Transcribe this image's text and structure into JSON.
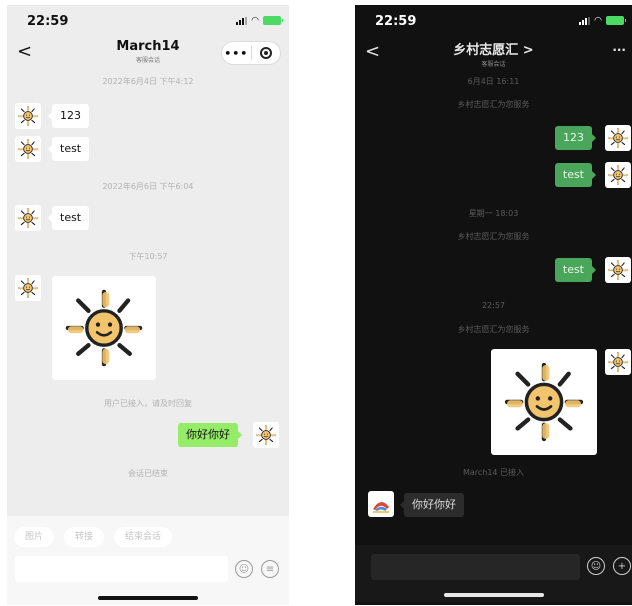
{
  "left": {
    "status": {
      "time": "22:59"
    },
    "nav": {
      "back": "<",
      "title": "March14",
      "subtitle": "客服会话",
      "more": "•••"
    },
    "messages": [
      {
        "kind": "stamp",
        "text": "2022年6月4日 下午4:12"
      },
      {
        "kind": "in",
        "text": "123"
      },
      {
        "kind": "in",
        "text": "test"
      },
      {
        "kind": "stamp",
        "text": "2022年6月6日 下午6:04"
      },
      {
        "kind": "in",
        "text": "test"
      },
      {
        "kind": "stamp",
        "text": "下午10:57"
      },
      {
        "kind": "in-image"
      },
      {
        "kind": "stamp",
        "text": "用户已接入，请及时回复"
      },
      {
        "kind": "out",
        "text": "你好你好"
      },
      {
        "kind": "stamp",
        "text": "会话已结束"
      }
    ],
    "quick_actions": [
      "图片",
      "转接",
      "结束会话"
    ],
    "icons": {
      "emoji": "emoji-icon",
      "more": "more-icon"
    }
  },
  "right": {
    "status": {
      "time": "22:59"
    },
    "nav": {
      "back": "<",
      "title": "乡村志愿汇 >",
      "subtitle": "客服会话",
      "more": "···"
    },
    "messages": [
      {
        "kind": "stamp",
        "text": "6月4日 16:11"
      },
      {
        "kind": "stamp",
        "text": "乡村志愿汇为您服务"
      },
      {
        "kind": "out",
        "text": "123"
      },
      {
        "kind": "out",
        "text": "test"
      },
      {
        "kind": "stamp",
        "text": "星期一 18:03"
      },
      {
        "kind": "stamp",
        "text": "乡村志愿汇为您服务"
      },
      {
        "kind": "out",
        "text": "test"
      },
      {
        "kind": "stamp",
        "text": "22:57"
      },
      {
        "kind": "stamp",
        "text": "乡村志愿汇为您服务"
      },
      {
        "kind": "out-image"
      },
      {
        "kind": "stamp",
        "text": "March14 已接入"
      },
      {
        "kind": "in",
        "text": "你好你好"
      }
    ],
    "icons": {
      "emoji": "emoji-icon",
      "plus": "plus-icon"
    },
    "plus": "+"
  },
  "colors": {
    "bubble_green": "#95ec69",
    "bubble_green_dark": "#4aa65a",
    "sun": "#f2c46d"
  }
}
